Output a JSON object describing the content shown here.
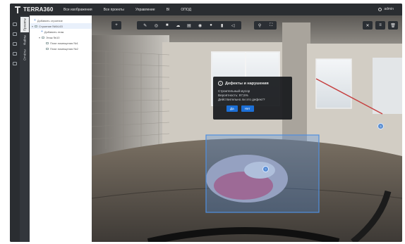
{
  "app": {
    "logo_text": "TERRA360",
    "nav": [
      {
        "label": "Все изображения"
      },
      {
        "label": "Все проекты"
      },
      {
        "label": "Управление"
      },
      {
        "label": "BI"
      },
      {
        "label": "ОПОД"
      }
    ],
    "user": {
      "name": "admin"
    }
  },
  "left_tabs": [
    {
      "label": "Проекты"
    },
    {
      "label": "Файлы"
    },
    {
      "label": "Отчёты"
    }
  ],
  "tree": [
    {
      "label": "Добавить строение",
      "depth": 1,
      "kind": "add"
    },
    {
      "label": "Строение №54-63",
      "depth": 1,
      "kind": "folder",
      "selected": true
    },
    {
      "label": "Добавить этаж",
      "depth": 2,
      "kind": "add"
    },
    {
      "label": "Этаж №10",
      "depth": 2,
      "kind": "folder"
    },
    {
      "label": "План помещения №1",
      "depth": 3,
      "kind": "item"
    },
    {
      "label": "План помещения №2",
      "depth": 3,
      "kind": "item"
    }
  ],
  "toolbar": {
    "left_icon": "plus-icon",
    "group_icons": [
      "pencil-icon",
      "target-icon",
      "square-icon",
      "cloud-icon",
      "table-icon",
      "eye-icon",
      "circle-icon",
      "doc-icon",
      "share-icon"
    ],
    "mid_icons": [
      "pin-icon",
      "fullscreen-icon"
    ],
    "right_icons": [
      "close-icon",
      "list-icon",
      "delete-icon"
    ]
  },
  "dialog": {
    "title": "Дефекты и нарушения",
    "lines": [
      "Строительный мусор",
      "Вероятность: 97,5%",
      "Действительно ли это дефект?"
    ],
    "buttons": [
      {
        "label": "Да"
      },
      {
        "label": "Нет"
      }
    ]
  },
  "markers": [
    {
      "label": "?"
    },
    {
      "label": "3"
    }
  ],
  "colors": {
    "accent": "#1c6fd6",
    "detection_box": "#4f8fe0",
    "topbar": "#2a2d31"
  }
}
